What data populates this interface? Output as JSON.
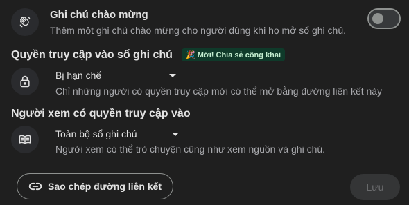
{
  "welcome": {
    "title": "Ghi chú chào mừng",
    "description": "Thêm một ghi chú chào mừng cho người dùng khi họ mở sổ ghi chú.",
    "toggle_on": false,
    "icon": "waving-hand-icon"
  },
  "access": {
    "heading": "Quyền truy cập vào sổ ghi chú",
    "badge": "🎉 Mới! Chia sẻ công khai",
    "selected": "Bị hạn chế",
    "description": "Chỉ những người có quyền truy cập mới có thể mở bằng đường liên kết này",
    "icon": "lock-icon"
  },
  "viewer": {
    "heading": "Người xem có quyền truy cập vào",
    "selected": "Toàn bộ sổ ghi chú",
    "description": "Người xem có thể trò chuyện cũng như xem nguồn và ghi chú.",
    "icon": "book-icon"
  },
  "footer": {
    "copy_link_label": "Sao chép đường liên kết",
    "save_label": "Lưu"
  },
  "colors": {
    "background": "#1f1f1f",
    "badge_bg": "#0f3a2a",
    "badge_text": "#c4eed0"
  }
}
